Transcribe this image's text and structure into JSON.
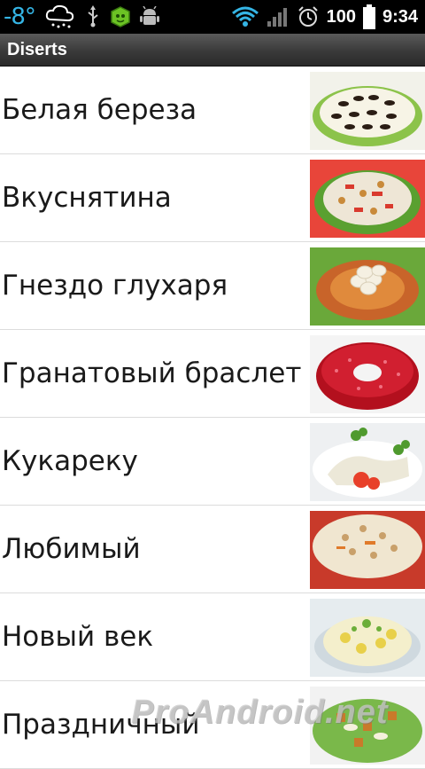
{
  "status_bar": {
    "temperature": "-8°",
    "battery": "100",
    "time": "9:34",
    "icons": [
      "weather-snow-icon",
      "usb-icon",
      "app-icon",
      "android-debug-icon",
      "wifi-icon",
      "signal-icon",
      "alarm-icon",
      "battery-icon"
    ]
  },
  "title_bar": {
    "title": "Diserts"
  },
  "items": [
    {
      "label": "Белая береза"
    },
    {
      "label": "Вкуснятина"
    },
    {
      "label": "Гнездо глухаря"
    },
    {
      "label": "Гранатовый браслет"
    },
    {
      "label": "Кукареку"
    },
    {
      "label": "Любимый"
    },
    {
      "label": "Новый век"
    },
    {
      "label": "Праздничный"
    }
  ],
  "watermark": "ProAndroid.net"
}
